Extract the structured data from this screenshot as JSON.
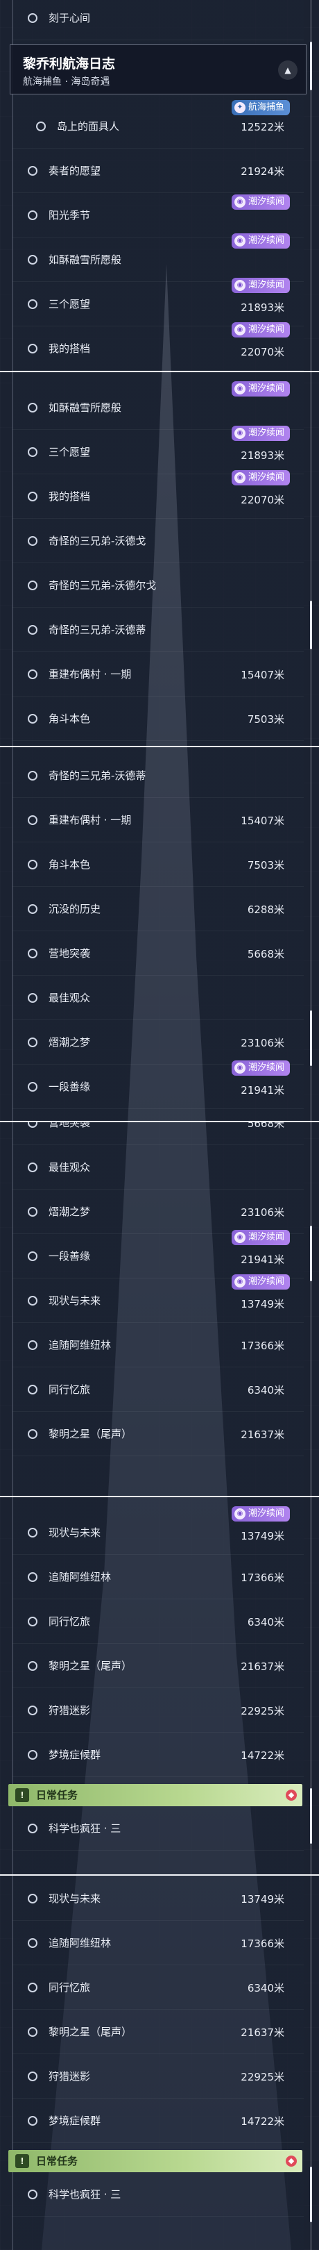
{
  "chapter": {
    "title": "黎乔利航海日志",
    "subtitle": "航海捕鱼 · 海岛奇遇",
    "collapse_icon": "triangle-up-icon"
  },
  "badges": {
    "chaoxi": "潮汐续闻",
    "fishing": "航海捕鱼"
  },
  "units": {
    "meter": "米"
  },
  "daily": {
    "title": "日常任务",
    "icon": "!"
  },
  "quests": {
    "kezai": {
      "title": "刻于心间"
    },
    "daoshang": {
      "title": "岛上的面具人",
      "dist": "12522米"
    },
    "zouzhe": {
      "title": "奏者的愿望",
      "dist": "21924米"
    },
    "yangguang": {
      "title": "阳光季节"
    },
    "rufu": {
      "title": "如酥融雪所愿般"
    },
    "sange": {
      "title": "三个愿望",
      "dist": "21893米"
    },
    "wode": {
      "title": "我的搭档",
      "dist": "22070米"
    },
    "qiguai1": {
      "title": "奇怪的三兄弟-沃德戈"
    },
    "qiguai2": {
      "title": "奇怪的三兄弟-沃德尔戈"
    },
    "qiguai3": {
      "title": "奇怪的三兄弟-沃德蒂"
    },
    "chongjian": {
      "title": "重建布偶村 · 一期",
      "dist": "15407米"
    },
    "jiaodou": {
      "title": "角斗本色",
      "dist": "7503米"
    },
    "chenmo": {
      "title": "沉没的历史",
      "dist": "6288米"
    },
    "yingdi": {
      "title": "营地突袭",
      "dist": "5668米"
    },
    "zuijia": {
      "title": "最佳观众"
    },
    "xichao": {
      "title": "熠潮之梦",
      "dist": "23106米"
    },
    "yiduan": {
      "title": "一段善缘",
      "dist": "21941米"
    },
    "xianzhuang": {
      "title": "现状与未来",
      "dist": "13749米"
    },
    "zhuisui": {
      "title": "追随阿维纽林",
      "dist": "17366米"
    },
    "tongxing": {
      "title": "同行忆旅",
      "dist": "6340米"
    },
    "liming": {
      "title": "黎明之星（尾声）",
      "dist": "21637米"
    },
    "lieyin": {
      "title": "狩猎迷影",
      "dist": "22925米"
    },
    "mengjing": {
      "title": "梦境症候群",
      "dist": "14722米"
    },
    "kexue": {
      "title": "科学也疯狂 · 三"
    }
  }
}
